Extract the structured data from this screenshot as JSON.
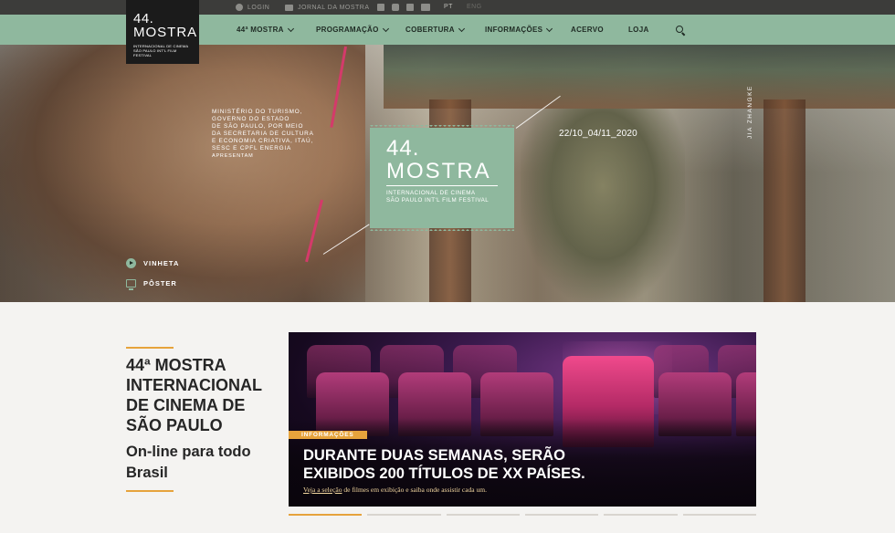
{
  "topbar": {
    "login": "LOGIN",
    "jornal": "JORNAL DA MOSTRA",
    "lang_pt": "PT",
    "lang_eng": "ENG"
  },
  "logo": {
    "num": "44.",
    "word": "MOSTRA",
    "sub_line1": "INTERNACIONAL DE CINEMA",
    "sub_line2": "SÃO PAULO INT'L FILM FESTIVAL"
  },
  "nav": {
    "items": [
      {
        "label": "44ª MOSTRA",
        "dropdown": true
      },
      {
        "label": "PROGRAMAÇÃO",
        "dropdown": true
      },
      {
        "label": "COBERTURA",
        "dropdown": true
      },
      {
        "label": "INFORMAÇÕES",
        "dropdown": true
      },
      {
        "label": "ACERVO",
        "dropdown": false
      },
      {
        "label": "LOJA",
        "dropdown": false
      }
    ]
  },
  "hero": {
    "ministry_lines": [
      "MINISTÉRIO DO TURISMO,",
      "GOVERNO DO ESTADO",
      "DE SÃO PAULO, POR MEIO",
      "DA SECRETARIA DE CULTURA",
      "E ECONOMIA CRIATIVA, ITAÚ,",
      "SESC E CPFL ENERGIA"
    ],
    "apresentam": "APRESENTAM",
    "badge": {
      "num": "44.",
      "word": "MOSTRA",
      "sub1": "INTERNACIONAL DE CINEMA",
      "sub2": "SÃO PAULO INT'L FILM FESTIVAL"
    },
    "dates": "22/10_04/11_2020",
    "credit": "JIA ZHANGKE",
    "vinheta": "VINHETA",
    "poster": "PÔSTER"
  },
  "intro": {
    "headline": "44ª MOSTRA INTERNACIONAL DE CINEMA DE SÃO PAULO",
    "subhead": "On-line para todo Brasil"
  },
  "card": {
    "tag": "INFORMAÇÕES",
    "title": "DURANTE DUAS SEMANAS, SERÃO EXIBIDOS 200 TÍTULOS DE XX PAÍSES.",
    "link_underlined": "Veja a seleção",
    "link_rest": " de filmes em exibição e saiba onde assistir cada um."
  },
  "carousel": {
    "slides": 6,
    "active": 1
  },
  "colors": {
    "accent_green": "#8fb89e",
    "accent_orange": "#e6a33c",
    "topbar": "#3c3c3a",
    "text_dark": "#262626"
  },
  "icons": [
    "user-icon",
    "newspaper-icon",
    "facebook-icon",
    "instagram-icon",
    "twitter-icon",
    "youtube-icon",
    "search-icon",
    "chevron-down-icon",
    "play-icon",
    "monitor-icon"
  ]
}
